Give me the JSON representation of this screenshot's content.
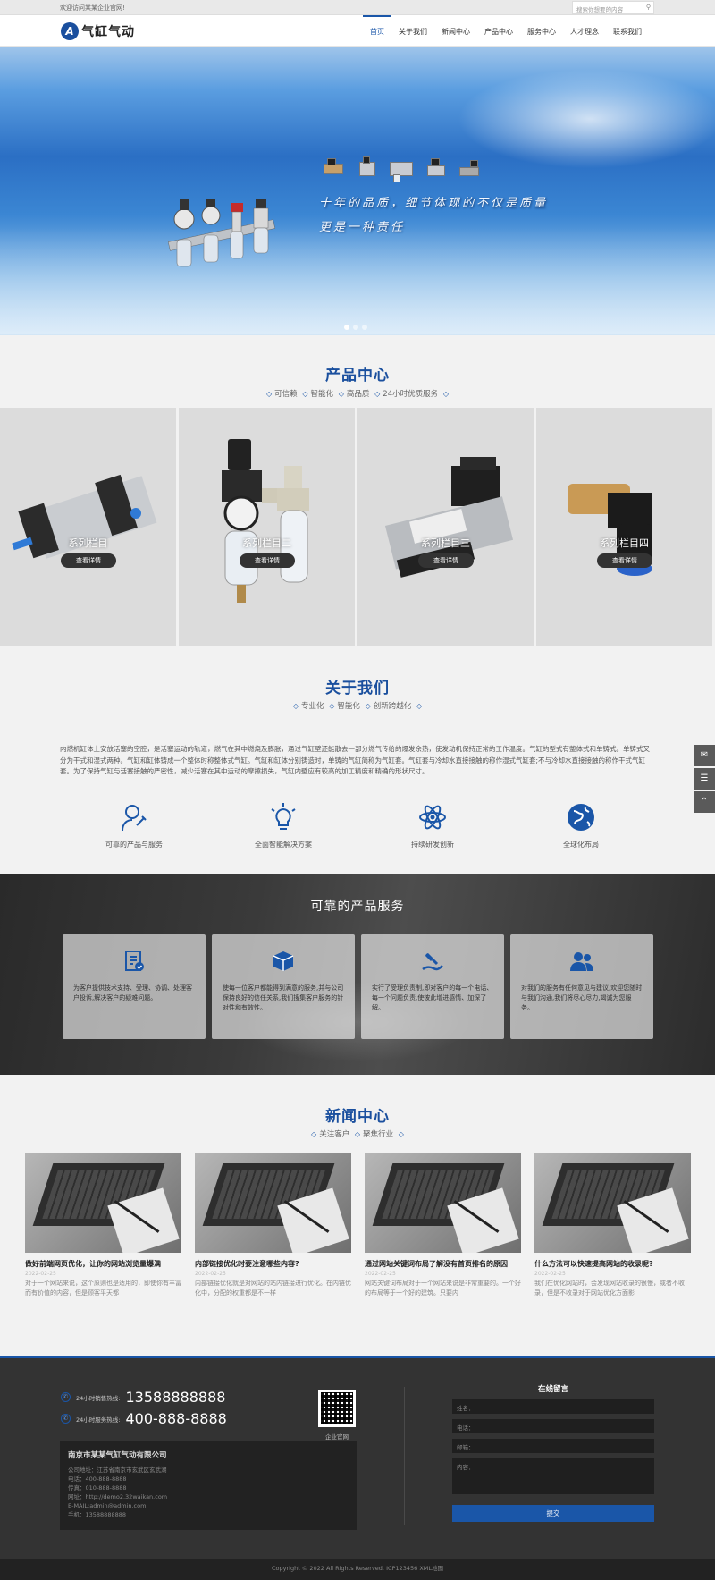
{
  "topbar": {
    "welcome": "欢迎访问某某企业官网!",
    "search_placeholder": "搜索你想要的内容"
  },
  "brand": {
    "logo_letter": "A",
    "name": "气缸气动"
  },
  "nav": [
    "首页",
    "关于我们",
    "新闻中心",
    "产品中心",
    "服务中心",
    "人才理念",
    "联系我们"
  ],
  "banner": {
    "line1": "十年的品质，细节体现的不仅是质量",
    "line2": "更是一种责任"
  },
  "products": {
    "title": "产品中心",
    "tags": [
      "可信赖",
      "智能化",
      "高品质",
      "24小时优质服务"
    ],
    "items": [
      {
        "label": "系列栏目",
        "button": "查看详情"
      },
      {
        "label": "系列栏目二",
        "button": "查看详情"
      },
      {
        "label": "系列栏目三",
        "button": "查看详情"
      },
      {
        "label": "系列栏目四",
        "button": "查看详情"
      }
    ]
  },
  "about": {
    "title": "关于我们",
    "tags": [
      "专业化",
      "智能化",
      "创新跨越化"
    ],
    "text": "内燃机缸体上安放活塞的空腔，是活塞运动的轨道，燃气在其中燃烧及膨胀，通过气缸壁还能散去一部分燃气传给的爆发余热，使发动机保持正常的工作温度。气缸的型式有整体式和单铸式。单铸式又分为干式和湿式两种。气缸和缸体铸成一个整体时称整体式气缸。气缸和缸体分别铸造时，单铸的气缸简称为气缸套。气缸套与冷却水直接接触的称作湿式气缸套;不与冷却水直接接触的称作干式气缸套。为了保持气缸与活塞接触的严密性，减少活塞在其中运动的摩擦损失，气缸内壁应有较高的加工精度和精确的形状尺寸。",
    "features": [
      "可靠的产品与服务",
      "全面智能解决方案",
      "持续研发创新",
      "全球化布局"
    ]
  },
  "service": {
    "title": "可靠的产品服务",
    "cards": [
      "为客户提供技术支持、受理、协调、处理客户投诉,解决客户的疑难问题。",
      "使每一位客户都能得到满意的服务,并与公司保持良好的信任关系,我们搜集客户服务的针对性和有效性。",
      "实行了受理负责制,即对客户的每一个电话、每一个问题负责,使彼此增进感情、加深了解。",
      "对我们的服务有任何意见与建议,欢迎您随时与我们沟通,我们将尽心尽力,竭诚为您服务。"
    ]
  },
  "news": {
    "title": "新闻中心",
    "tags": [
      "关注客户",
      "聚焦行业"
    ],
    "items": [
      {
        "title": "做好前端网页优化，让你的网站浏览量爆满",
        "date": "2022-02-25",
        "summary": "对于一个网站来说，这个原则也是适用的，即使你有丰富而有价值的内容，但是顾客平天都"
      },
      {
        "title": "内部链接优化时要注意哪些内容?",
        "date": "2022-02-25",
        "summary": "内部链接优化就是对网站的站内链接进行优化。在内链优化中，分配的权重都是不一样"
      },
      {
        "title": "通过网站关键词布局了解没有首页排名的原因",
        "date": "2022-02-25",
        "summary": "网站关键词布局对于一个网站来说是非常重要的。一个好的布局等于一个好的建筑。只要内"
      },
      {
        "title": "什么方法可以快速提高网站的收录呢?",
        "date": "2022-02-25",
        "summary": "我们在优化网站时，会发现网站收录的很慢，或者不收录，但是不收录对于网站优化方面影"
      }
    ]
  },
  "footer": {
    "hotline_label": "24小时销售热线:",
    "hotline": "13588888888",
    "service_label": "24小时服务热线:",
    "service_line": "400-888-8888",
    "qr_label": "企业官网",
    "company": "南京市某某气缸气动有限公司",
    "address": "公司地址：江苏省南京市玄武区玄武湖",
    "phone": "电话：400-888-8888",
    "fax": "传真：010-888-8888",
    "website": "网址：http://demo2.32waikan.com",
    "email": "E-MAIL:admin@admin.com",
    "mobile": "手机：13588888888",
    "form_title": "在线留言",
    "name_ph": "姓名：",
    "tel_ph": "电话：",
    "mail_ph": "邮箱：",
    "content_ph": "内容：",
    "submit": "提交",
    "copyright": "Copyright © 2022 All Rights Reserved.  ICP123456  XML地图"
  }
}
